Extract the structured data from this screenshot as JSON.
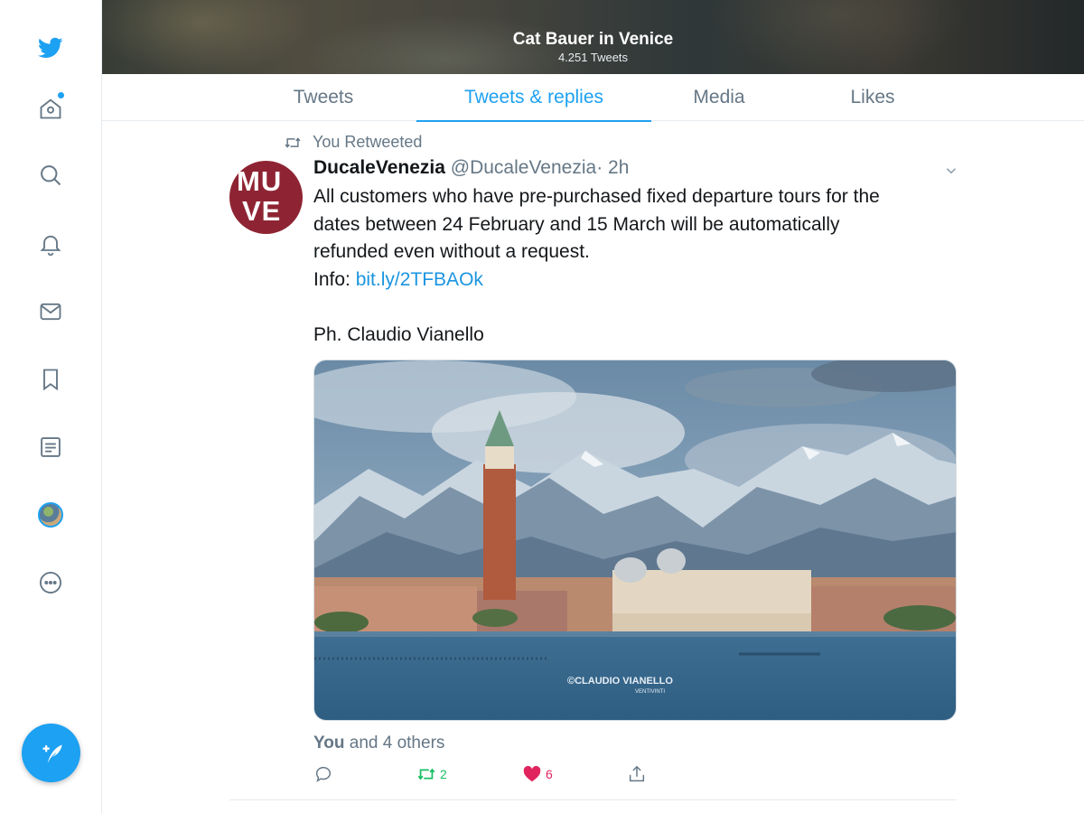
{
  "nav": {
    "items": [
      {
        "icon": "twitter-bird-icon"
      },
      {
        "icon": "home-icon"
      },
      {
        "icon": "search-icon"
      },
      {
        "icon": "bell-icon"
      },
      {
        "icon": "mail-icon"
      },
      {
        "icon": "bookmark-icon"
      },
      {
        "icon": "list-icon"
      },
      {
        "icon": "profile-avatar"
      },
      {
        "icon": "more-icon"
      }
    ],
    "compose_icon": "compose-tweet-icon"
  },
  "header": {
    "title": "Cat Bauer in Venice",
    "subtitle": "4.251 Tweets"
  },
  "tabs": [
    {
      "label": "Tweets",
      "active": false
    },
    {
      "label": "Tweets & replies",
      "active": true
    },
    {
      "label": "Media",
      "active": false
    },
    {
      "label": "Likes",
      "active": false
    }
  ],
  "tweet": {
    "retweet_label": "You Retweeted",
    "avatar_text": [
      "MU",
      "VE"
    ],
    "name": "DucaleVenezia",
    "handle": "@DucaleVenezia",
    "time": "· 2h",
    "text_lines": [
      "All customers who have pre-purchased fixed departure tours for the",
      "dates between 24 February and 15 March will be automatically",
      "refunded even without a request."
    ],
    "info_label": "Info: ",
    "link": "bit.ly/2TFBAOk",
    "credit": "Ph. Claudio Vianello",
    "media_watermark": "©CLAUDIO VIANELLO",
    "media_watermark_sub": "VENTIVINTI",
    "liked_by_bold": "You",
    "liked_by_rest": " and 4 others",
    "retweet_count": "2",
    "like_count": "6"
  },
  "colors": {
    "accent": "#1da1f2",
    "retweet": "#17bf63",
    "like": "#e0245e",
    "muted": "#657786"
  }
}
